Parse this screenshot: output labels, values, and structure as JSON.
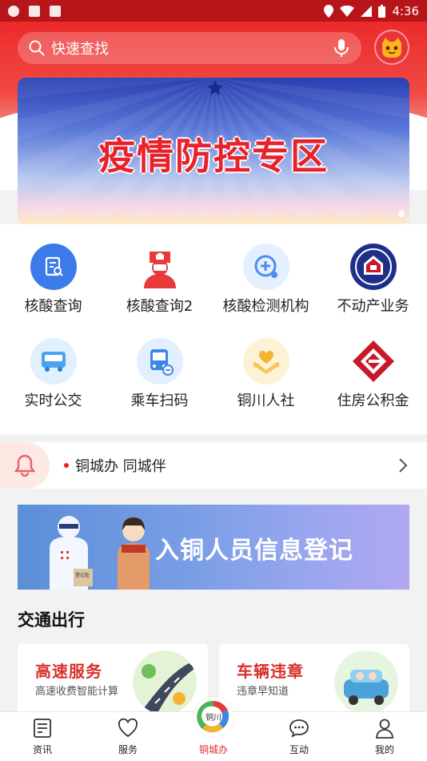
{
  "status_bar": {
    "time": "4:36"
  },
  "search": {
    "placeholder": "快速查找"
  },
  "banner": {
    "title": "疫情防控专区"
  },
  "services": [
    {
      "label": "核酸查询",
      "icon": "report-search-icon",
      "color": "#3d7bea"
    },
    {
      "label": "核酸查询2",
      "icon": "nurse-icon",
      "color": "#e8393b"
    },
    {
      "label": "核酸检测机构",
      "icon": "plus-search-icon",
      "color": "#4a8ef0"
    },
    {
      "label": "不动产业务",
      "icon": "real-estate-seal-icon",
      "color": "#1e2f8a"
    },
    {
      "label": "实时公交",
      "icon": "bus-icon",
      "color": "#4aa3f0"
    },
    {
      "label": "乘车扫码",
      "icon": "bus-scan-icon",
      "color": "#3d86e6"
    },
    {
      "label": "铜川人社",
      "icon": "heart-hands-icon",
      "color": "#f2b431"
    },
    {
      "label": "住房公积金",
      "icon": "housing-fund-logo-icon",
      "color": "#c8192a"
    }
  ],
  "notice": {
    "text": "铜城办 同城伴"
  },
  "register_banner": {
    "title": "入铜人员信息登记",
    "sign_text": "登记处"
  },
  "traffic": {
    "title": "交通出行",
    "cards": [
      {
        "title": "高速服务",
        "subtitle": "高速收费智能计算"
      },
      {
        "title": "车辆违章",
        "subtitle": "违章早知道"
      }
    ]
  },
  "tabbar": {
    "tabs": [
      {
        "label": "资讯",
        "icon": "news-icon"
      },
      {
        "label": "服务",
        "icon": "heart-icon"
      },
      {
        "label": "铜城办",
        "icon": "tongcheng-logo-icon",
        "active": true
      },
      {
        "label": "互动",
        "icon": "chat-icon"
      },
      {
        "label": "我的",
        "icon": "person-icon"
      }
    ],
    "center_logo_text": "铜川"
  },
  "colors": {
    "brand_red": "#e8333a",
    "active_tab": "#e02b2b"
  }
}
